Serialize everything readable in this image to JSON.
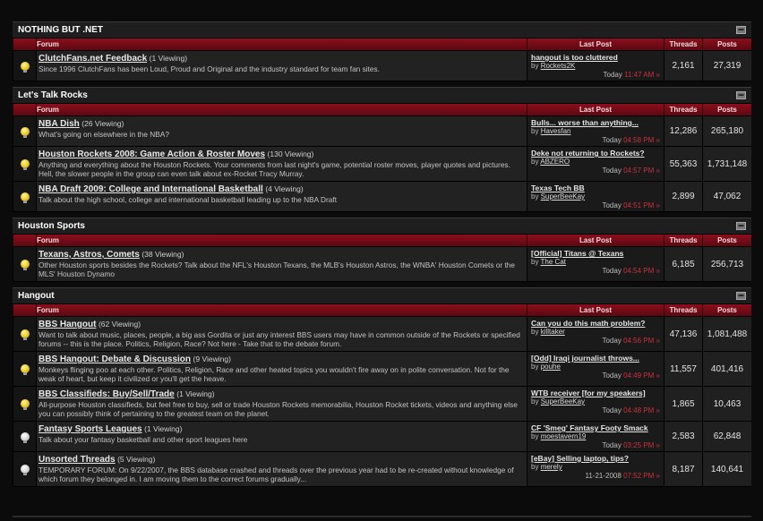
{
  "columns": {
    "forum": "Forum",
    "last_post": "Last Post",
    "threads": "Threads",
    "posts": "Posts"
  },
  "categories": [
    {
      "title": "NOTHING BUT .NET",
      "forums": [
        {
          "title": "ClutchFans.net Feedback",
          "viewing": "(1 Viewing)",
          "desc": "Since 1996 ClutchFans has been Loud, Proud and Original and the industry standard for team fan sites.",
          "lp_title": "hangout is too cluttered",
          "lp_by": "by",
          "lp_user": "Rockets2K",
          "lp_day": "Today",
          "lp_time": "11:47 AM",
          "threads": "2,161",
          "posts": "27,319",
          "bulb": "on"
        }
      ]
    },
    {
      "title": "Let's Talk Rocks",
      "forums": [
        {
          "title": "NBA Dish",
          "viewing": "(26 Viewing)",
          "desc": "What's going on elsewhere in the NBA?",
          "lp_title": "Bulls... worse than anything...",
          "lp_by": "by",
          "lp_user": "Havesfan",
          "lp_day": "Today",
          "lp_time": "04:58 PM",
          "threads": "12,286",
          "posts": "265,180",
          "bulb": "on"
        },
        {
          "title": "Houston Rockets 2008: Game Action & Roster Moves",
          "viewing": "(130 Viewing)",
          "desc": "Anything and everything about the Houston Rockets. Your comments from last night's game, potential roster moves, player quotes and pictures. Hell, the slower people in the group can even talk about ex-Rocket Tracy Murray.",
          "lp_title": "Deke not returning to Rockets?",
          "lp_by": "by",
          "lp_user": "ABZERO",
          "lp_day": "Today",
          "lp_time": "04:57 PM",
          "threads": "55,363",
          "posts": "1,731,148",
          "bulb": "on"
        },
        {
          "title": "NBA Draft 2009: College and International Basketball",
          "viewing": "(4 Viewing)",
          "desc": "Talk about the high school, college and international basketball leading up to the NBA Draft",
          "lp_title": "Texas Tech BB",
          "lp_by": "by",
          "lp_user": "SuperBeeKay",
          "lp_day": "Today",
          "lp_time": "04:51 PM",
          "threads": "2,899",
          "posts": "47,062",
          "bulb": "on"
        }
      ]
    },
    {
      "title": "Houston Sports",
      "forums": [
        {
          "title": "Texans, Astros, Comets",
          "viewing": "(38 Viewing)",
          "desc": "Other Houston sports besides the Rockets? Talk about the NFL's Houston Texans, the MLB's Houston Astros, the WNBA' Houston Comets or the MLS' Houston Dynamo",
          "lp_title": "[Official] Titans @ Texans",
          "lp_by": "by",
          "lp_user": "The Cat",
          "lp_day": "Today",
          "lp_time": "04:54 PM",
          "threads": "6,185",
          "posts": "256,713",
          "bulb": "on"
        }
      ]
    },
    {
      "title": "Hangout",
      "forums": [
        {
          "title": "BBS Hangout",
          "viewing": "(62 Viewing)",
          "desc": "Want to talk about music, places, people, a big ass Gordita or just any interest BBS users may have in common outside of the Rockets or specified forums -- this is the place. Politics, Religion, Race? Not here - Take that to the debate forum.",
          "lp_title": "Can you do this math problem?",
          "lp_by": "by",
          "lp_user": "killtaker",
          "lp_day": "Today",
          "lp_time": "04:56 PM",
          "threads": "47,136",
          "posts": "1,081,488",
          "bulb": "on"
        },
        {
          "title": "BBS Hangout: Debate & Discussion",
          "viewing": "(9 Viewing)",
          "desc": "Monkeys flinging poo at each other. Politics, Religion, Race and other heated topics you wouldn't fire away on in polite conversation. Not for the weak of heart, but keep it civilized or you'll get the heave.",
          "lp_title": "[Odd] Iraqi journalist throws...",
          "lp_by": "by",
          "lp_user": "pouhe",
          "lp_day": "Today",
          "lp_time": "04:49 PM",
          "threads": "11,557",
          "posts": "401,416",
          "bulb": "on"
        },
        {
          "title": "BBS Classifieds: Buy/Sell/Trade",
          "viewing": "(1 Viewing)",
          "desc": "All-purpose Houston classifieds, but feel free to buy, sell or trade Houston Rockets memorabilia, Houston Rocket tickets, videos and anything else you can possibly think of pertaining to the greatest team on the planet.",
          "lp_title": "WTB receiver [for my speakers]",
          "lp_by": "by",
          "lp_user": "SuperBeeKay",
          "lp_day": "Today",
          "lp_time": "04:48 PM",
          "threads": "1,865",
          "posts": "10,463",
          "bulb": "on"
        },
        {
          "title": "Fantasy Sports Leagues",
          "viewing": "(1 Viewing)",
          "desc": "Talk about your fantasy basketball and other sport leagues here",
          "lp_title": "CF 'Smeg' Fantasy Footy Smack",
          "lp_by": "by",
          "lp_user": "moestavern19",
          "lp_day": "Today",
          "lp_time": "03:25 PM",
          "threads": "2,583",
          "posts": "62,848",
          "bulb": "off"
        },
        {
          "title": "Unsorted Threads",
          "viewing": "(5 Viewing)",
          "desc": "TEMPORARY FORUM: On 9/22/2007, the BBS database crashed and threads over the previous year had to be re-created without knowledge of which forum they belonged in. I am moving them to the correct forums gradually...",
          "lp_title": "[eBay] Selling laptop, tips?",
          "lp_by": "by",
          "lp_user": "merely",
          "lp_day": "11-21-2008",
          "lp_time": "07:52 PM",
          "threads": "8,187",
          "posts": "140,641",
          "bulb": "off"
        }
      ]
    }
  ],
  "icons": {
    "collapse": "collapse-icon",
    "bulb_on": "lightbulb-new-posts-icon",
    "bulb_off": "lightbulb-no-new-posts-icon",
    "goto": "go-to-last-post-icon"
  },
  "colors": {
    "header_red": "#8a0f1c",
    "accent_red": "#c8323f",
    "background": "#0b0b0b"
  }
}
